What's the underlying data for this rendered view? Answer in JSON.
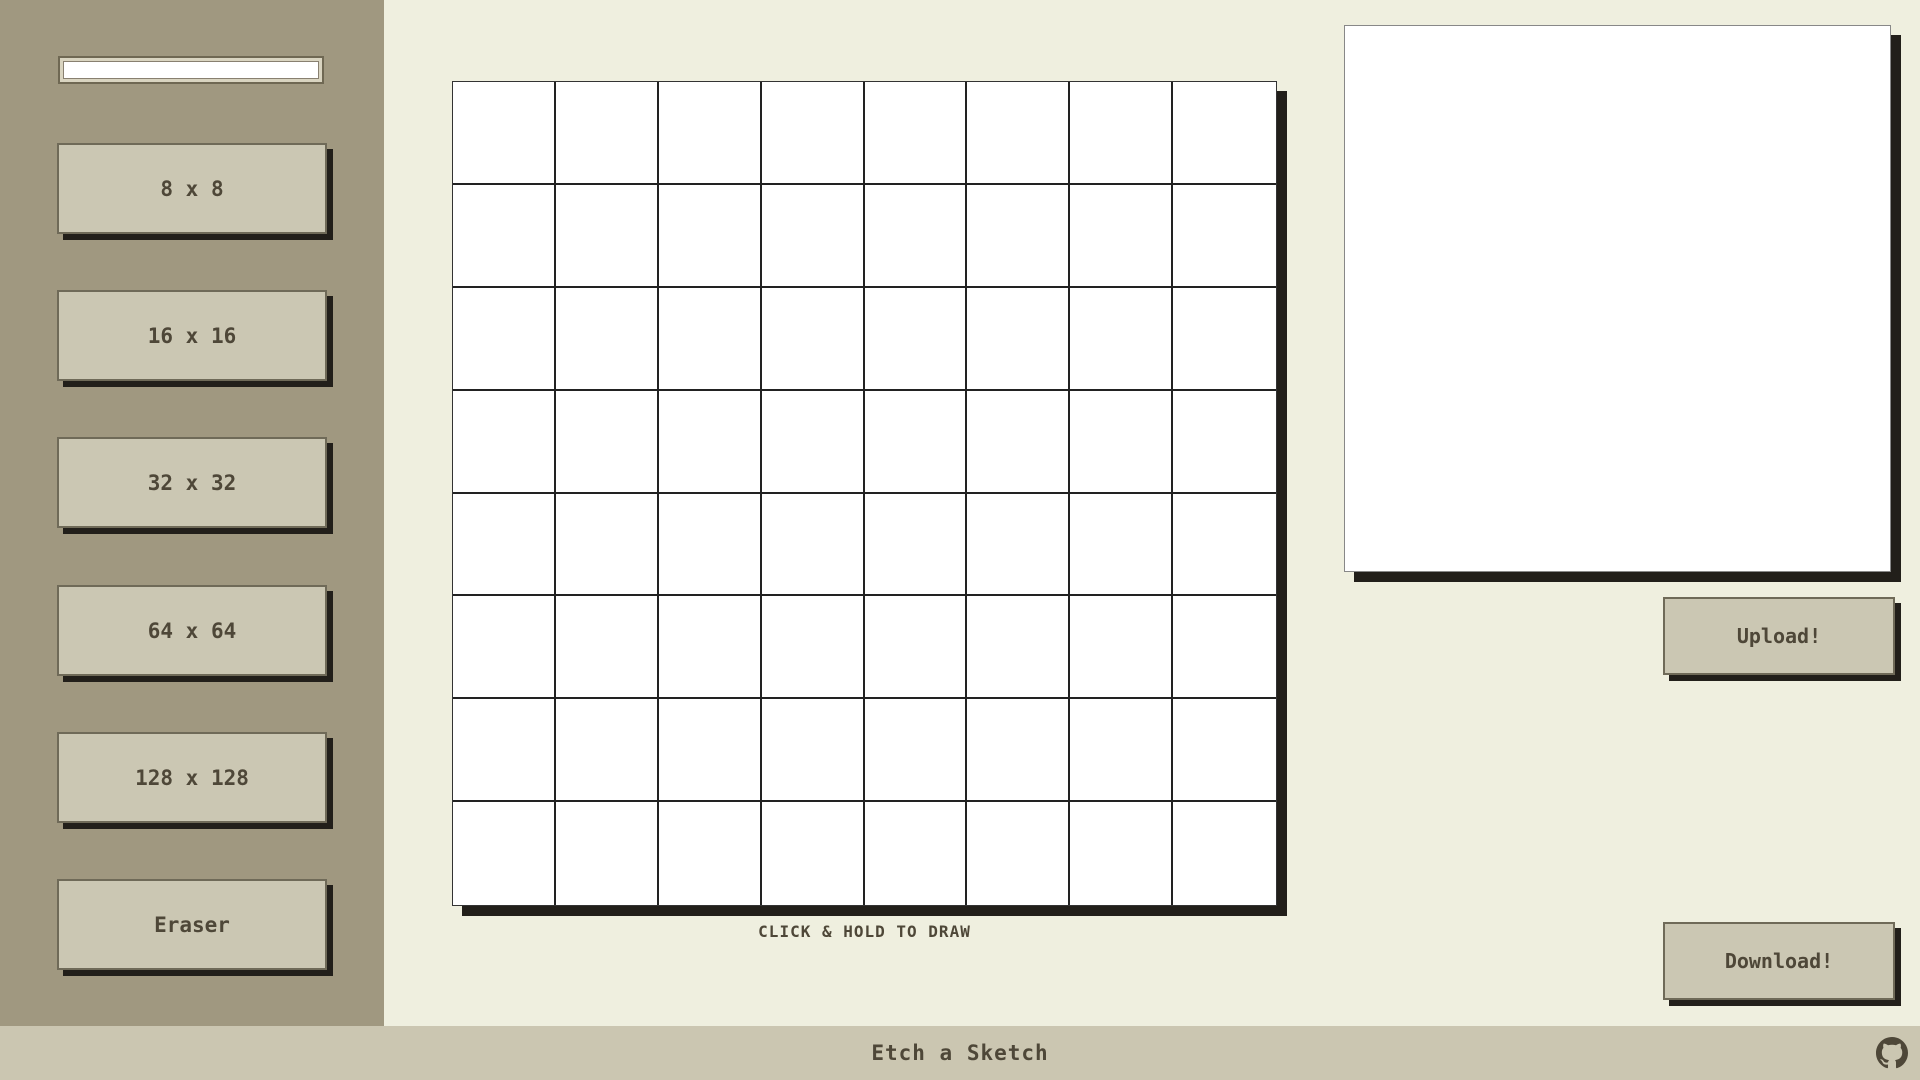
{
  "sidebar": {
    "color_picker": {
      "value": "#ffffff"
    },
    "buttons": [
      {
        "label": "8 x 8"
      },
      {
        "label": "16 x 16"
      },
      {
        "label": "32 x 32"
      },
      {
        "label": "64 x 64"
      },
      {
        "label": "128 x 128"
      },
      {
        "label": "Eraser"
      }
    ]
  },
  "canvas": {
    "grid_size": 8,
    "hint": "CLICK & HOLD TO DRAW"
  },
  "preview": {
    "upload_label": "Upload!",
    "download_label": "Download!"
  },
  "footer": {
    "title": "Etch a Sketch",
    "icon": "github-icon"
  },
  "colors": {
    "sidebar_bg": "#a09880",
    "page_bg": "#efefdf",
    "button_bg": "#cbc7b3",
    "shadow": "#221f1a",
    "text": "#4e4738"
  }
}
